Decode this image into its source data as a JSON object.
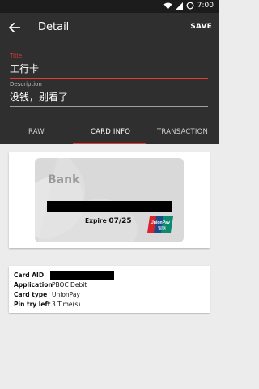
{
  "status_bar": {
    "time": "7:00",
    "icons": [
      "wifi-icon",
      "signal-icon",
      "alarm-circle-icon"
    ]
  },
  "app_bar": {
    "title": "Detail",
    "save_label": "SAVE"
  },
  "form": {
    "title_label": "Title",
    "title_value": "工行卡",
    "description_label": "Description",
    "description_value": "没钱，别看了"
  },
  "tabs": [
    {
      "label": "RAW",
      "active": false
    },
    {
      "label": "CARD INFO",
      "active": true
    },
    {
      "label": "TRANSACTION",
      "active": false
    }
  ],
  "bank_card": {
    "bank": "Bank",
    "expire_label": "Expire",
    "expire_value": "07/25",
    "logo_name": "UnionPay",
    "logo_cn": "银联"
  },
  "card_info": [
    {
      "key": "Card AID",
      "value": ""
    },
    {
      "key": "Application",
      "value": "PBOC Debit"
    },
    {
      "key": "Card type",
      "value": "UnionPay"
    },
    {
      "key": "Pin try left",
      "value": "3 Time(s)"
    }
  ],
  "colors": {
    "accent": "#e53935",
    "appbar": "#2f2f2f",
    "statusbar": "#1c1c1c",
    "background": "#ececec"
  }
}
